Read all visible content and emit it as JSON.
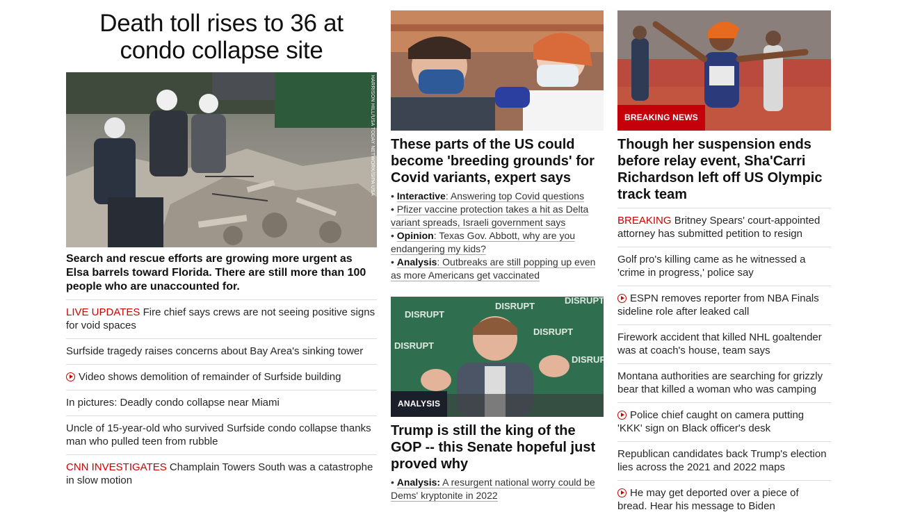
{
  "col1": {
    "headline": "Death toll rises to 36 at condo collapse site",
    "photo_credit": "HARRISON HILL/USA TODAY NETWORK/SIPA USA",
    "caption": "Search and rescue efforts are growing more urgent as Elsa barrels toward Florida. There are still more than 100 people who are unaccounted for.",
    "links": [
      {
        "tag": "LIVE UPDATES",
        "text": " Fire chief says crews are not seeing positive signs for void spaces",
        "video": false
      },
      {
        "tag": "",
        "text": "Surfside tragedy raises concerns about Bay Area's sinking tower",
        "video": false
      },
      {
        "tag": "",
        "text": "Video shows demolition of remainder of Surfside building",
        "video": true
      },
      {
        "tag": "",
        "text": "In pictures: Deadly condo collapse near Miami",
        "video": false
      },
      {
        "tag": "",
        "text": "Uncle of 15-year-old who survived Surfside condo collapse thanks man who pulled teen from rubble",
        "video": false
      },
      {
        "tag": "CNN INVESTIGATES",
        "text": " Champlain Towers South was a catastrophe in slow motion",
        "video": false
      }
    ]
  },
  "col2": {
    "story1": {
      "title": "These parts of the US could become 'breeding grounds' for Covid variants, expert says",
      "sublinks": [
        {
          "bullet": "•",
          "bold": "Interactive",
          "rest": ": Answering top Covid questions"
        },
        {
          "bullet": "•",
          "bold": "",
          "rest": "Pfizer vaccine protection takes a hit as Delta variant spreads, Israeli government says"
        },
        {
          "bullet": "•",
          "bold": "Opinion",
          "rest": ": Texas Gov. Abbott, why are you endangering my kids?"
        },
        {
          "bullet": "•",
          "bold": "Analysis",
          "rest": ": Outbreaks are still popping up even as more Americans get vaccinated"
        }
      ]
    },
    "story2": {
      "tag": "ANALYSIS",
      "title": "Trump is still the king of the GOP -- this Senate hopeful just proved why",
      "sublinks": [
        {
          "bullet": "•",
          "bold": "Analysis:",
          "rest": " A resurgent national worry could be Dems' kryptonite in 2022"
        }
      ],
      "backdrop_text": "DISRUPT"
    }
  },
  "col3": {
    "tag": "BREAKING NEWS",
    "title": "Though her suspension ends before relay event, Sha'Carri Richardson left off US Olympic track team",
    "links": [
      {
        "tag": "BREAKING",
        "text": " Britney Spears' court-appointed attorney has submitted petition to resign",
        "video": false
      },
      {
        "tag": "",
        "text": "Golf pro's killing came as he witnessed a 'crime in progress,' police say",
        "video": false
      },
      {
        "tag": "",
        "text": "ESPN removes reporter from NBA Finals sideline role after leaked call",
        "video": true
      },
      {
        "tag": "",
        "text": "Firework accident that killed NHL goaltender was at coach's house, team says",
        "video": false
      },
      {
        "tag": "",
        "text": "Montana authorities are searching for grizzly bear that killed a woman who was camping",
        "video": false
      },
      {
        "tag": "",
        "text": "Police chief caught on camera putting 'KKK' sign on Black officer's desk",
        "video": true
      },
      {
        "tag": "",
        "text": "Republican candidates back Trump's election lies across the 2021 and 2022 maps",
        "video": false
      },
      {
        "tag": "",
        "text": "He may get deported over a piece of bread. Hear his message to Biden",
        "video": true
      }
    ]
  },
  "colors": {
    "accent_red": "#cc0000",
    "tag_red": "#c4000a",
    "tag_dark": "#1b1f2a"
  }
}
